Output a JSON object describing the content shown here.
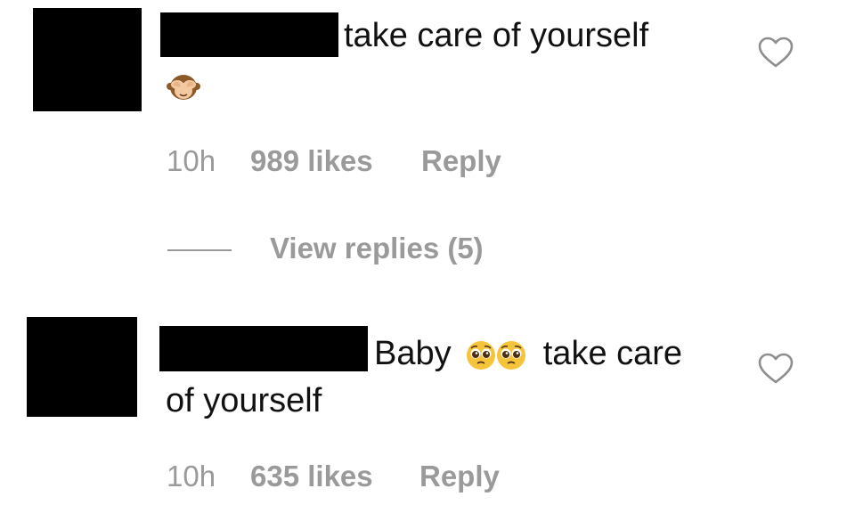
{
  "comments": [
    {
      "text": "take care of yourself",
      "emoji_line_icon": "see-no-evil-monkey-emoji",
      "time": "10h",
      "likes": "989 likes",
      "reply": "Reply"
    },
    {
      "text_before": "Baby",
      "emoji_icons": [
        "pleading-face-emoji",
        "pleading-face-emoji"
      ],
      "text_after": "take care",
      "text_line2": "of yourself",
      "time": "10h",
      "likes": "635 likes",
      "reply": "Reply"
    }
  ],
  "view_replies": "View replies (5)",
  "colors": {
    "text": "#111111",
    "meta": "#9a9a9a",
    "redaction": "#000000",
    "heart_stroke": "#8e8e8e"
  },
  "icons": {
    "like": "heart-outline-icon"
  }
}
